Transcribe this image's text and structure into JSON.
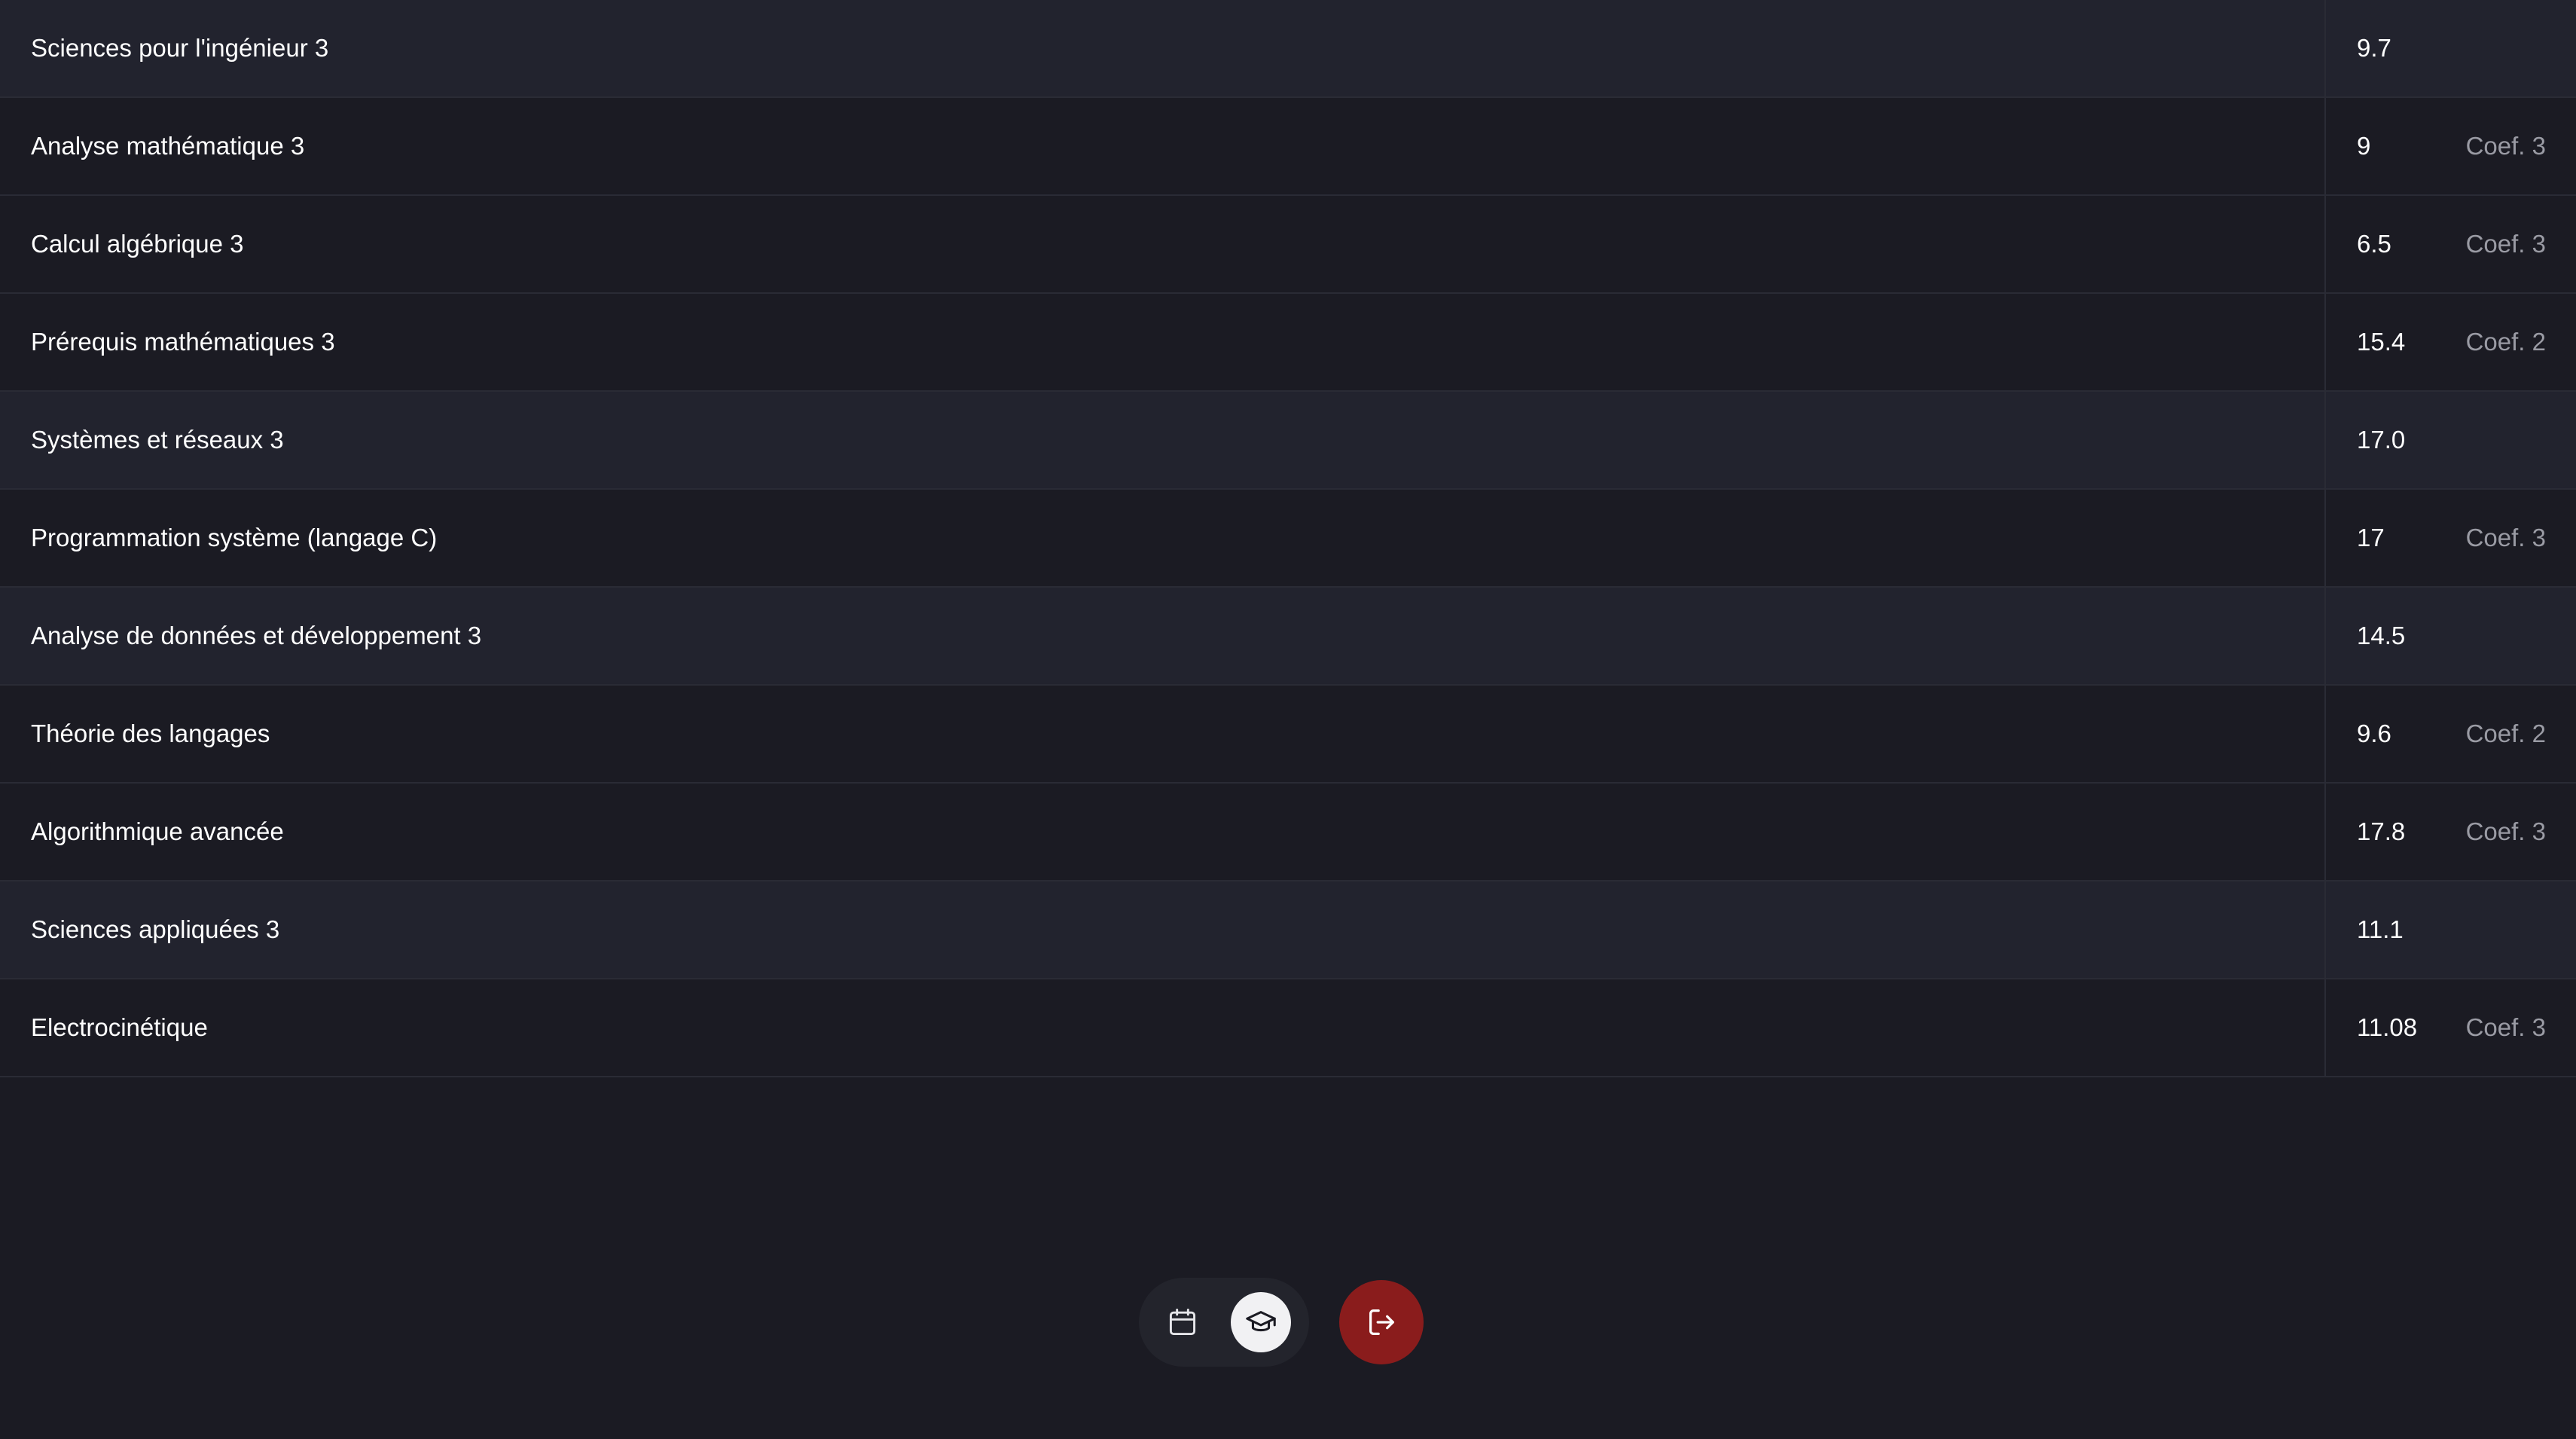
{
  "grades": [
    {
      "name": "Sciences pour l'ingénieur 3",
      "grade": "9.7",
      "coef": "",
      "kind": "ue"
    },
    {
      "name": "Analyse mathématique 3",
      "grade": "9",
      "coef": "Coef. 3",
      "kind": "module"
    },
    {
      "name": "Calcul algébrique 3",
      "grade": "6.5",
      "coef": "Coef. 3",
      "kind": "module"
    },
    {
      "name": "Prérequis mathématiques 3",
      "grade": "15.4",
      "coef": "Coef. 2",
      "kind": "module"
    },
    {
      "name": "Systèmes et réseaux 3",
      "grade": "17.0",
      "coef": "",
      "kind": "ue"
    },
    {
      "name": "Programmation système (langage C)",
      "grade": "17",
      "coef": "Coef. 3",
      "kind": "module"
    },
    {
      "name": "Analyse de données et développement 3",
      "grade": "14.5",
      "coef": "",
      "kind": "ue"
    },
    {
      "name": "Théorie des langages",
      "grade": "9.6",
      "coef": "Coef. 2",
      "kind": "module"
    },
    {
      "name": "Algorithmique avancée",
      "grade": "17.8",
      "coef": "Coef. 3",
      "kind": "module"
    },
    {
      "name": "Sciences appliquées 3",
      "grade": "11.1",
      "coef": "",
      "kind": "ue"
    },
    {
      "name": "Electrocinétique",
      "grade": "11.08",
      "coef": "Coef. 3",
      "kind": "module"
    }
  ],
  "nav": {
    "items": [
      {
        "icon": "calendar-icon",
        "active": false
      },
      {
        "icon": "graduation-cap-icon",
        "active": true
      }
    ],
    "logout_icon": "logout-icon"
  },
  "colors": {
    "background": "#1b1b23",
    "ue_row": "#22232e",
    "divider": "#2a2b35",
    "text": "#ffffff",
    "muted": "#9a9ba4",
    "active_nav": "#f1f1f3",
    "logout": "#8a1c1c"
  }
}
